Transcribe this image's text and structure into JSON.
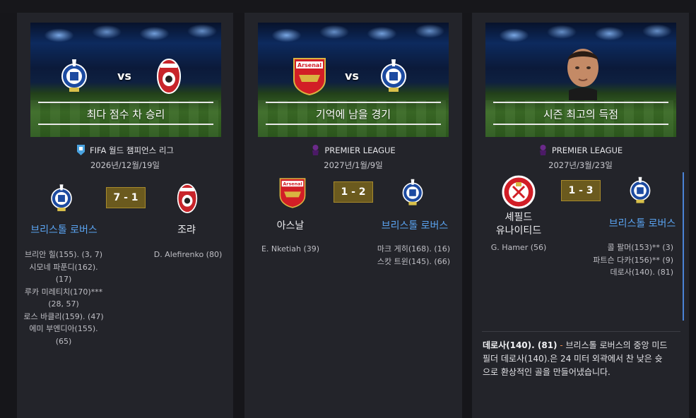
{
  "cards": [
    {
      "banner_caption": "최다 점수 차 승리",
      "banner_vs": "vs",
      "competition": "FIFA 월드 챔피언스 리그",
      "date": "2026년/12월/19일",
      "score": "7 - 1",
      "home": {
        "name": "브리스톨 로버스",
        "crest": "bristol-rovers-crest-icon"
      },
      "away": {
        "name": "조랴",
        "crest": "zorya-crest-icon"
      },
      "home_scorers": [
        "브리안 힐(155). (3, 7)",
        "시모네 파푼디(162).",
        "(17)",
        "루카 미레티치(170)***",
        "(28, 57)",
        "로스 바클리(159). (47)",
        "에미 부엔디아(155).",
        "(65)"
      ],
      "away_scorers": [
        "D. Alefirenko (80)"
      ]
    },
    {
      "banner_caption": "기억에 남을 경기",
      "banner_vs": "vs",
      "banner_crest_text": "Arsenal",
      "competition": "PREMIER LEAGUE",
      "date": "2027년/1월/9일",
      "score": "1 - 2",
      "home": {
        "name": "아스날",
        "crest": "arsenal-crest-icon",
        "crest_text": "Arsenal"
      },
      "away": {
        "name": "브리스톨 로버스",
        "crest": "bristol-rovers-crest-icon"
      },
      "home_scorers": [
        "E. Nketiah (39)"
      ],
      "away_scorers": [
        "마크 게히(168). (16)",
        "스캇 트윈(145). (66)"
      ]
    },
    {
      "banner_caption": "시즌 최고의 득점",
      "competition": "PREMIER LEAGUE",
      "date": "2027년/3월/23일",
      "score": "1 - 3",
      "home": {
        "name_line1": "셰필드",
        "name_line2": "유나이티드",
        "crest": "sheffield-united-crest-icon"
      },
      "away": {
        "name": "브리스톨 로버스",
        "crest": "bristol-rovers-crest-icon"
      },
      "home_scorers": [
        "G. Hamer (56)"
      ],
      "away_scorers": [
        "콜 팔머(153)** (3)",
        "파트슨 다카(156)** (9)",
        "데로사(140). (81)"
      ],
      "description": {
        "bold": "데로사(140). (81)",
        "dash": " - ",
        "text": "브리스톨 로버스의 중앙 미드필더 데로사(140).은 24 미터 외곽에서 찬 낮은 슛으로 환상적인 골을 만들어냈습니다."
      }
    }
  ],
  "colors": {
    "link": "#5aa3f0",
    "score_bg": "#6b5a1e",
    "card_bg": "#23242a",
    "page_bg": "#16161a"
  }
}
